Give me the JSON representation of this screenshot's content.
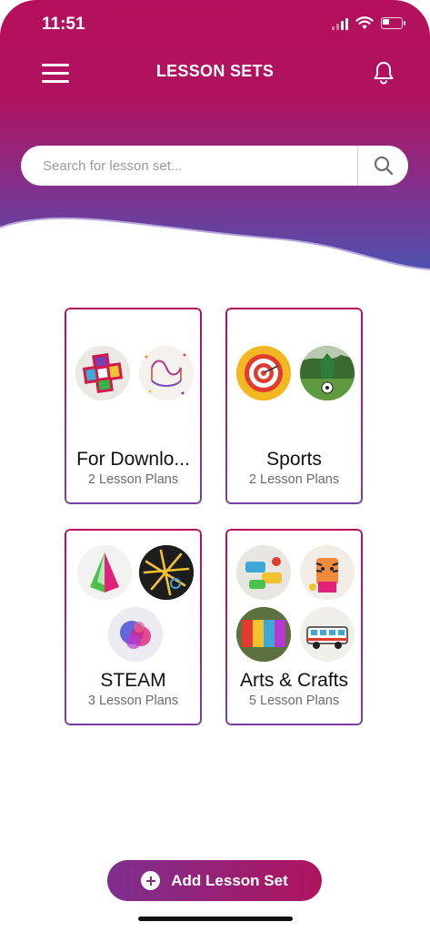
{
  "status_bar": {
    "time": "11:51"
  },
  "header": {
    "title": "LESSON SETS"
  },
  "search": {
    "placeholder": "Search for lesson set..."
  },
  "lesson_sets": [
    {
      "title": "For Downlo...",
      "count": "2 Lesson Plans",
      "thumbnails": [
        "cross-shaped-craft-thumbnail",
        "beaded-string-thumbnail"
      ]
    },
    {
      "title": "Sports",
      "count": "2 Lesson Plans",
      "thumbnails": [
        "target-dart-board-thumbnail",
        "soccer-ball-field-thumbnail"
      ]
    },
    {
      "title": "STEAM",
      "count": "3 Lesson Plans",
      "thumbnails": [
        "paper-pyramid-thumbnail",
        "yellow-sticks-thumbnail",
        "color-splash-thumbnail"
      ]
    },
    {
      "title": "Arts & Crafts",
      "count": "5 Lesson Plans",
      "thumbnails": [
        "toy-cars-thumbnail",
        "tiger-mask-thumbnail",
        "peace-letters-thumbnail",
        "paper-bus-thumbnail"
      ]
    }
  ],
  "add_button": {
    "label": "Add Lesson Set"
  },
  "colors": {
    "header_top": "#b5105f",
    "header_bottom": "#5c4aa8",
    "card_border": "#9b2a80"
  }
}
